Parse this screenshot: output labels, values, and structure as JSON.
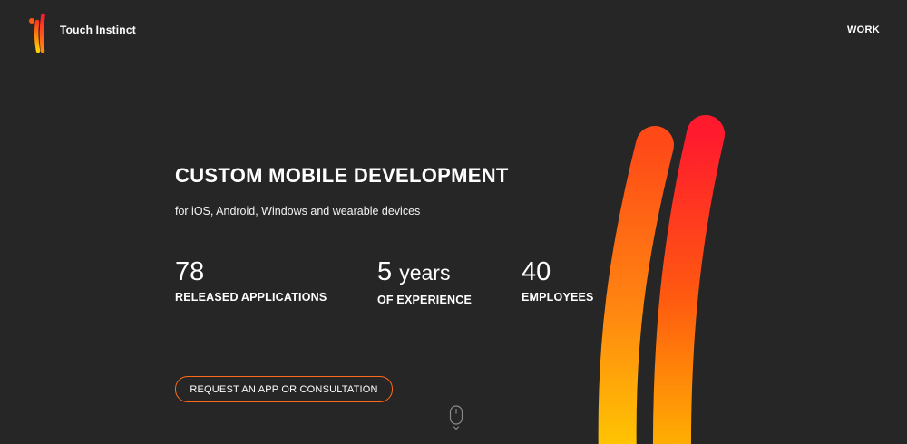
{
  "header": {
    "logo_text": "Touch Instinct",
    "nav": {
      "work_label": "WORK"
    }
  },
  "hero": {
    "title": "CUSTOM MOBILE DEVELOPMENT",
    "subtitle": "for iOS, Android, Windows and wearable devices",
    "stats": [
      {
        "value": "78",
        "unit": "",
        "label": "RELEASED APPLICATIONS"
      },
      {
        "value": "5",
        "unit": "years",
        "label": "OF EXPERIENCE"
      },
      {
        "value": "40",
        "unit": "",
        "label": "EMPLOYEES"
      }
    ],
    "cta_label": "REQUEST AN APP OR CONSULTATION"
  },
  "icons": {
    "logo": "touch-instinct-logo-icon",
    "scroll": "mouse-scroll-icon"
  },
  "colors": {
    "background": "#262626",
    "text": "#ffffff",
    "accent": "#ff6a1a",
    "gradient_top": "#ff1a2e",
    "gradient_mid": "#ff6a10",
    "gradient_bottom": "#ffcc00"
  }
}
